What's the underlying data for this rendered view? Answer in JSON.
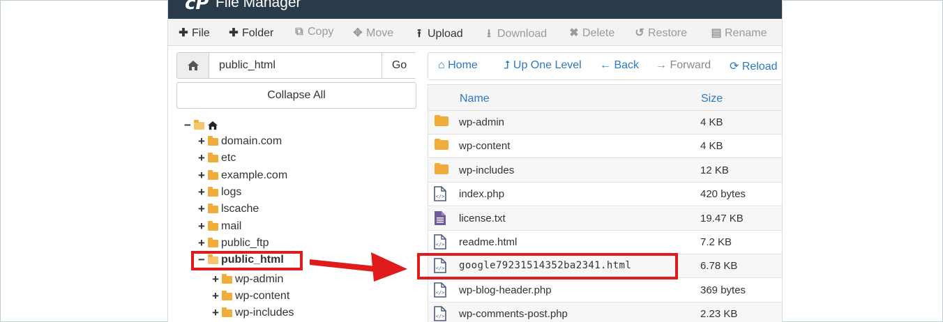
{
  "app": {
    "title": "File Manager",
    "logo": "cP"
  },
  "toolbar": {
    "file": "File",
    "folder": "Folder",
    "copy": "Copy",
    "move": "Move",
    "upload": "Upload",
    "download": "Download",
    "delete": "Delete",
    "restore": "Restore",
    "rename": "Rename"
  },
  "path": {
    "value": "public_html",
    "go": "Go"
  },
  "collapse_label": "Collapse All",
  "tree": {
    "items": [
      {
        "label": "domain.com"
      },
      {
        "label": "etc"
      },
      {
        "label": "example.com"
      },
      {
        "label": "logs"
      },
      {
        "label": "lscache"
      },
      {
        "label": "mail"
      },
      {
        "label": "public_ftp"
      },
      {
        "label": "public_html"
      },
      {
        "label": "wp-admin"
      },
      {
        "label": "wp-content"
      },
      {
        "label": "wp-includes"
      }
    ]
  },
  "nav": {
    "home": "Home",
    "up": "Up One Level",
    "back": "Back",
    "forward": "Forward",
    "reload": "Reload"
  },
  "table": {
    "headers": {
      "name": "Name",
      "size": "Size"
    },
    "rows": [
      {
        "name": "wp-admin",
        "size": "4 KB",
        "type": "folder"
      },
      {
        "name": "wp-content",
        "size": "4 KB",
        "type": "folder"
      },
      {
        "name": "wp-includes",
        "size": "12 KB",
        "type": "folder"
      },
      {
        "name": "index.php",
        "size": "420 bytes",
        "type": "code"
      },
      {
        "name": "license.txt",
        "size": "19.47 KB",
        "type": "text"
      },
      {
        "name": "readme.html",
        "size": "7.2 KB",
        "type": "code"
      },
      {
        "name": "google79231514352ba2341.html",
        "size": "6.78 KB",
        "type": "code"
      },
      {
        "name": "wp-blog-header.php",
        "size": "369 bytes",
        "type": "code"
      },
      {
        "name": "wp-comments-post.php",
        "size": "2.23 KB",
        "type": "code"
      }
    ]
  },
  "colors": {
    "accent": "#2a79c1",
    "highlight": "#e01b1b",
    "folder": "#f0ad3c",
    "titlebar": "#293a4a"
  }
}
